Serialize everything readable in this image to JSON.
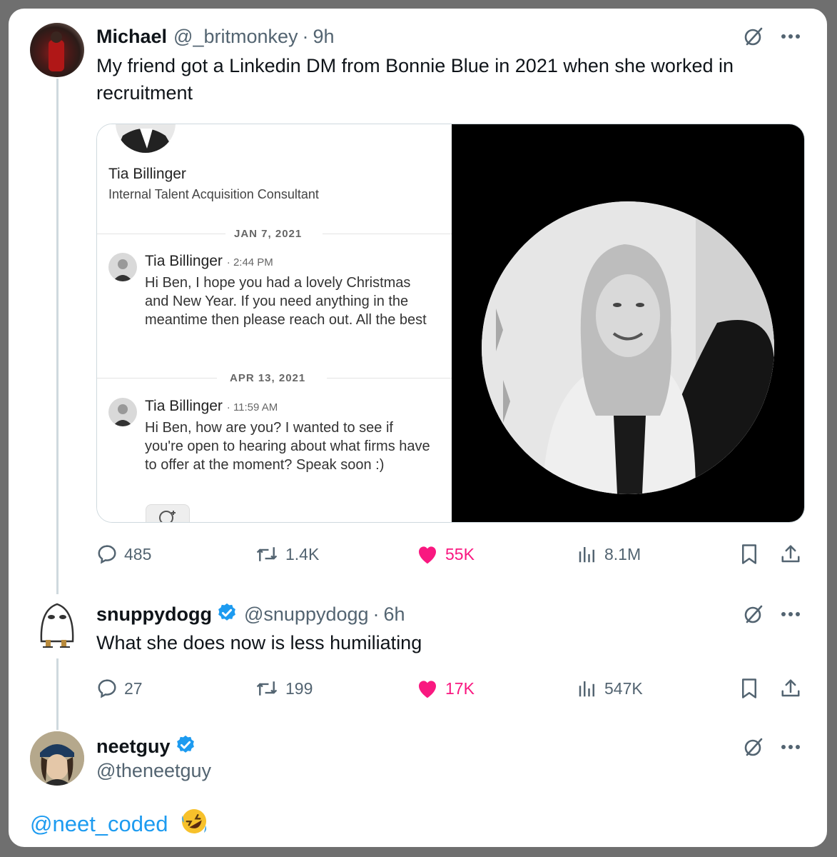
{
  "tweet1": {
    "name": "Michael",
    "handle": "@_britmonkey",
    "dot": "·",
    "time": "9h",
    "text": "My friend got a Linkedin DM from Bonnie Blue in 2021 when she worked in recruitment",
    "media": {
      "profile_name": "Tia Billinger",
      "profile_title": "Internal Talent Acquisition Consultant",
      "messages": [
        {
          "date": "JAN 7, 2021",
          "sender": "Tia Billinger",
          "time": "· 2:44 PM",
          "body": "Hi Ben, I hope you had a lovely Christmas and New Year. If you need anything in the meantime then please reach out. All the best"
        },
        {
          "date": "APR 13, 2021",
          "sender": "Tia Billinger",
          "time": "· 11:59 AM",
          "body": "Hi Ben, how are you? I wanted to see if you're open to hearing about what firms have to offer at the moment? Speak soon :)"
        }
      ]
    },
    "metrics": {
      "replies": "485",
      "reposts": "1.4K",
      "likes": "55K",
      "views": "8.1M"
    }
  },
  "tweet2": {
    "name": "snuppydogg",
    "handle": "@snuppydogg",
    "dot": "·",
    "time": "6h",
    "text": "What she does now is less humiliating",
    "metrics": {
      "replies": "27",
      "reposts": "199",
      "likes": "17K",
      "views": "547K"
    }
  },
  "tweet3": {
    "name": "neetguy",
    "handle": "@theneetguy",
    "mention": "@neet_coded"
  },
  "colors": {
    "like": "#f91880",
    "verified": "#1d9bf0",
    "muted": "#536471",
    "link": "#1d9bf0"
  },
  "icons": [
    "reply-icon",
    "repost-icon",
    "heart-icon",
    "views-icon",
    "bookmark-icon",
    "share-icon",
    "grok-icon",
    "more-icon",
    "verified-icon",
    "rofl-emoji-icon"
  ]
}
